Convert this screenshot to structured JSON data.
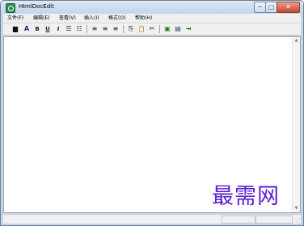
{
  "window": {
    "title": "HtmlDocEdit",
    "controls": {
      "minimize": "─",
      "maximize": "□",
      "close": "✕"
    }
  },
  "menubar": {
    "items": [
      {
        "label": "文件(F)"
      },
      {
        "label": "编辑(E)"
      },
      {
        "label": "查看(V)"
      },
      {
        "label": "插入(I)"
      },
      {
        "label": "格式(O)"
      },
      {
        "label": "帮助(H)"
      }
    ]
  },
  "toolbar": {
    "buttons": [
      {
        "icon": "font-color-icon",
        "glyph": "▆"
      },
      {
        "icon": "font-icon",
        "glyph": "A"
      },
      {
        "icon": "bold-icon",
        "glyph": "B"
      },
      {
        "icon": "underline-icon",
        "glyph": "U"
      },
      {
        "icon": "italic-icon",
        "glyph": "I"
      },
      {
        "icon": "numbered-list-icon",
        "glyph": "☰"
      },
      {
        "icon": "bullet-list-icon",
        "glyph": "☷"
      },
      {
        "icon": "align-left-icon",
        "glyph": "≡"
      },
      {
        "icon": "align-center-icon",
        "glyph": "≡"
      },
      {
        "icon": "align-right-icon",
        "glyph": "≡"
      },
      {
        "icon": "copy-icon",
        "glyph": "⎘"
      },
      {
        "icon": "paste-icon",
        "glyph": "📋"
      },
      {
        "icon": "cut-icon",
        "glyph": "✂"
      },
      {
        "icon": "new-icon",
        "glyph": "▣"
      },
      {
        "icon": "save-icon",
        "glyph": "▤"
      },
      {
        "icon": "exit-icon",
        "glyph": "⇥"
      }
    ]
  },
  "scroll": {
    "up": "▲",
    "down": "▼"
  },
  "status": {
    "grip": "⋰"
  },
  "watermark": {
    "text": "最需网"
  }
}
